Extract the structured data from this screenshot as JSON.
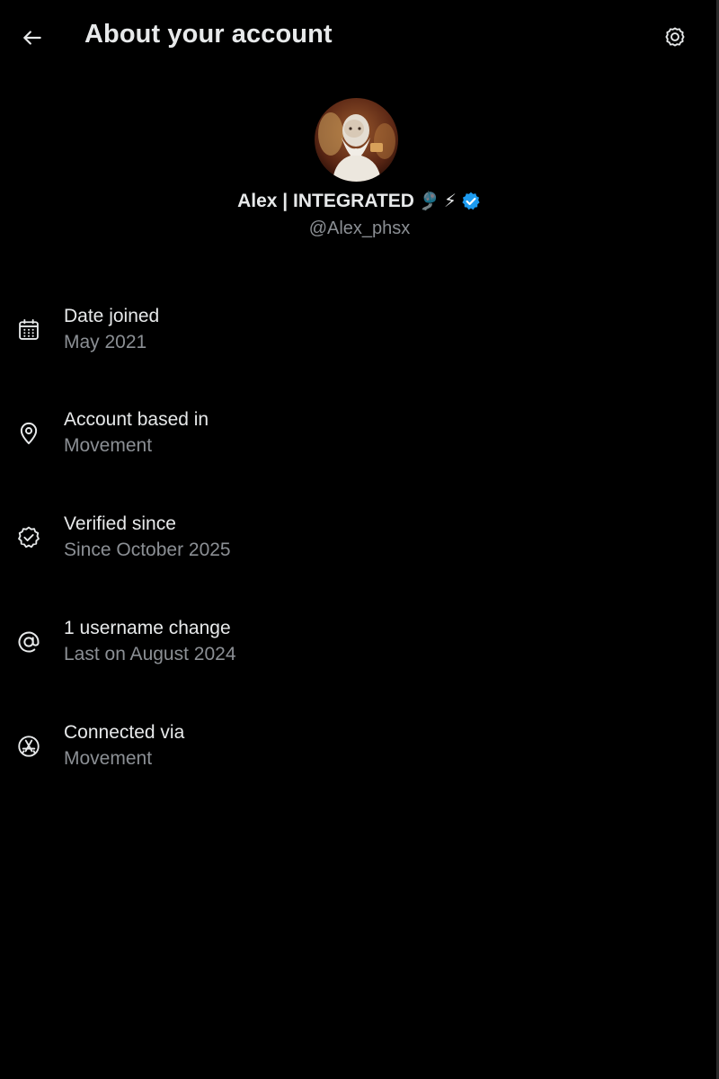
{
  "header": {
    "title": "About your account",
    "back_icon": "arrow-left-icon",
    "settings_icon": "gear-icon"
  },
  "profile": {
    "display_name": "Alex | INTEGRATED",
    "name_emojis": [
      "🎐",
      "⚡"
    ],
    "verified_badge_color": "#1d9bf0",
    "handle": "@Alex_phsx"
  },
  "info_items": [
    {
      "icon": "calendar-icon",
      "label": "Date joined",
      "value": "May 2021"
    },
    {
      "icon": "location-pin-icon",
      "label": "Account based in",
      "value": "Movement"
    },
    {
      "icon": "verified-check-icon",
      "label": "Verified since",
      "value": "Since October 2025"
    },
    {
      "icon": "at-sign-icon",
      "label": "1 username change",
      "value": "Last on August 2024"
    },
    {
      "icon": "app-store-icon",
      "label": "Connected via",
      "value": "Movement"
    }
  ],
  "colors": {
    "background": "#000000",
    "primary_text": "#e7e9ea",
    "secondary_text": "#8b8f94",
    "accent": "#1d9bf0"
  }
}
